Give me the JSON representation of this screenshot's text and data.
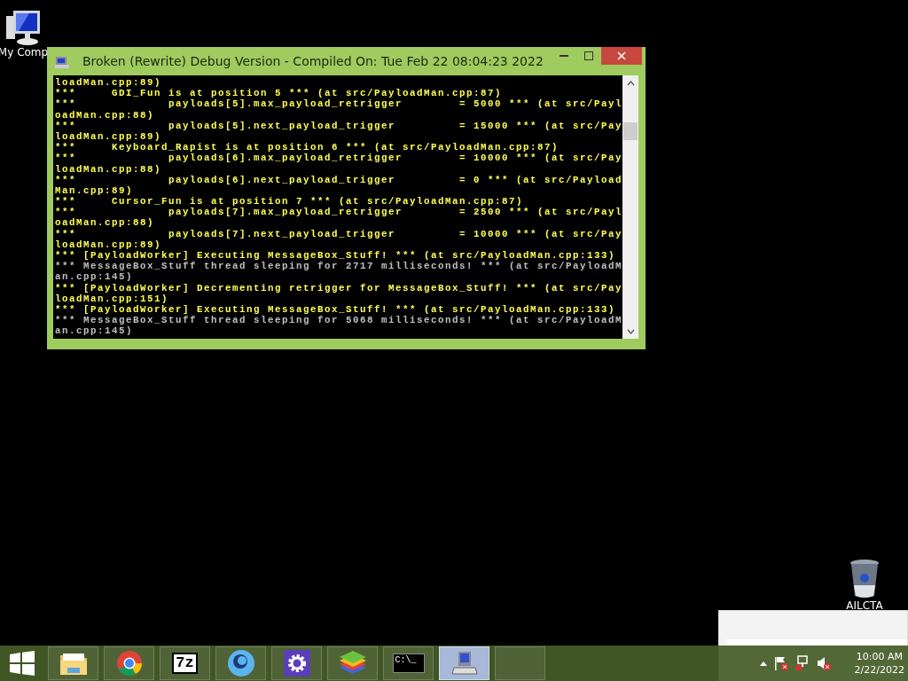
{
  "desktop": {
    "icons": [
      {
        "kind": "computer",
        "label": "My Comp"
      },
      {
        "kind": "bin",
        "label": "AILCTA"
      }
    ]
  },
  "window": {
    "title": "Broken (Rewrite) Debug Version - Compiled On: Tue Feb 22 08:04:23 2022",
    "lines": [
      {
        "text": "loadMan.cpp:89)",
        "color": "#ffff55"
      },
      {
        "text": "***     GDI_Fun is at position 5 *** (at src/PayloadMan.cpp:87)",
        "color": "#ffff55"
      },
      {
        "text": "***             payloads[5].max_payload_retrigger        = 5000 *** (at src/Payl",
        "color": "#ffff55"
      },
      {
        "text": "oadMan.cpp:88)",
        "color": "#ffff55"
      },
      {
        "text": "***             payloads[5].next_payload_trigger         = 15000 *** (at src/Pay",
        "color": "#ffff55"
      },
      {
        "text": "loadMan.cpp:89)",
        "color": "#ffff55"
      },
      {
        "text": "***     Keyboard_Rapist is at position 6 *** (at src/PayloadMan.cpp:87)",
        "color": "#ffff55"
      },
      {
        "text": "***             payloads[6].max_payload_retrigger        = 10000 *** (at src/Pay",
        "color": "#ffff55"
      },
      {
        "text": "loadMan.cpp:88)",
        "color": "#ffff55"
      },
      {
        "text": "***             payloads[6].next_payload_trigger         = 0 *** (at src/Payload",
        "color": "#ffff55"
      },
      {
        "text": "Man.cpp:89)",
        "color": "#ffff55"
      },
      {
        "text": "***     Cursor_Fun is at position 7 *** (at src/PayloadMan.cpp:87)",
        "color": "#ffff55"
      },
      {
        "text": "***             payloads[7].max_payload_retrigger        = 2500 *** (at src/Payl",
        "color": "#ffff55"
      },
      {
        "text": "oadMan.cpp:88)",
        "color": "#ffff55"
      },
      {
        "text": "***             payloads[7].next_payload_trigger         = 10000 *** (at src/Pay",
        "color": "#ffff55"
      },
      {
        "text": "loadMan.cpp:89)",
        "color": "#ffff55"
      },
      {
        "text": "*** [PayloadWorker] Executing MessageBox_Stuff! *** (at src/PayloadMan.cpp:133)",
        "color": "#ffff55"
      },
      {
        "text": "*** MessageBox_Stuff thread sleeping for 2717 milliseconds! *** (at src/PayloadM",
        "color": "#c0c0c0"
      },
      {
        "text": "an.cpp:145)",
        "color": "#c0c0c0"
      },
      {
        "text": "*** [PayloadWorker] Decrementing retrigger for MessageBox_Stuff! *** (at src/Pay",
        "color": "#ffff55"
      },
      {
        "text": "loadMan.cpp:151)",
        "color": "#ffff55"
      },
      {
        "text": "*** [PayloadWorker] Executing MessageBox_Stuff! *** (at src/PayloadMan.cpp:133)",
        "color": "#ffff55"
      },
      {
        "text": "*** MessageBox_Stuff thread sleeping for 5068 milliseconds! *** (at src/PayloadM",
        "color": "#c0c0c0"
      },
      {
        "text": "an.cpp:145)",
        "color": "#c0c0c0"
      }
    ]
  },
  "taskbar": {
    "buttons": [
      {
        "kind": "folder",
        "selected": false
      },
      {
        "kind": "ball",
        "selected": false
      },
      {
        "kind": "archive",
        "label": "7z",
        "selected": false
      },
      {
        "kind": "ring",
        "selected": false
      },
      {
        "kind": "gear",
        "selected": false
      },
      {
        "kind": "stack",
        "selected": false
      },
      {
        "kind": "console",
        "label": "C:\\_",
        "selected": false
      },
      {
        "kind": "app",
        "selected": true
      },
      {
        "kind": "blank",
        "selected": false
      }
    ],
    "tray": [
      {
        "kind": "flag"
      },
      {
        "kind": "network"
      },
      {
        "kind": "speaker"
      }
    ],
    "clock": {
      "time": "10:00 AM",
      "date": "2/22/2022"
    }
  }
}
